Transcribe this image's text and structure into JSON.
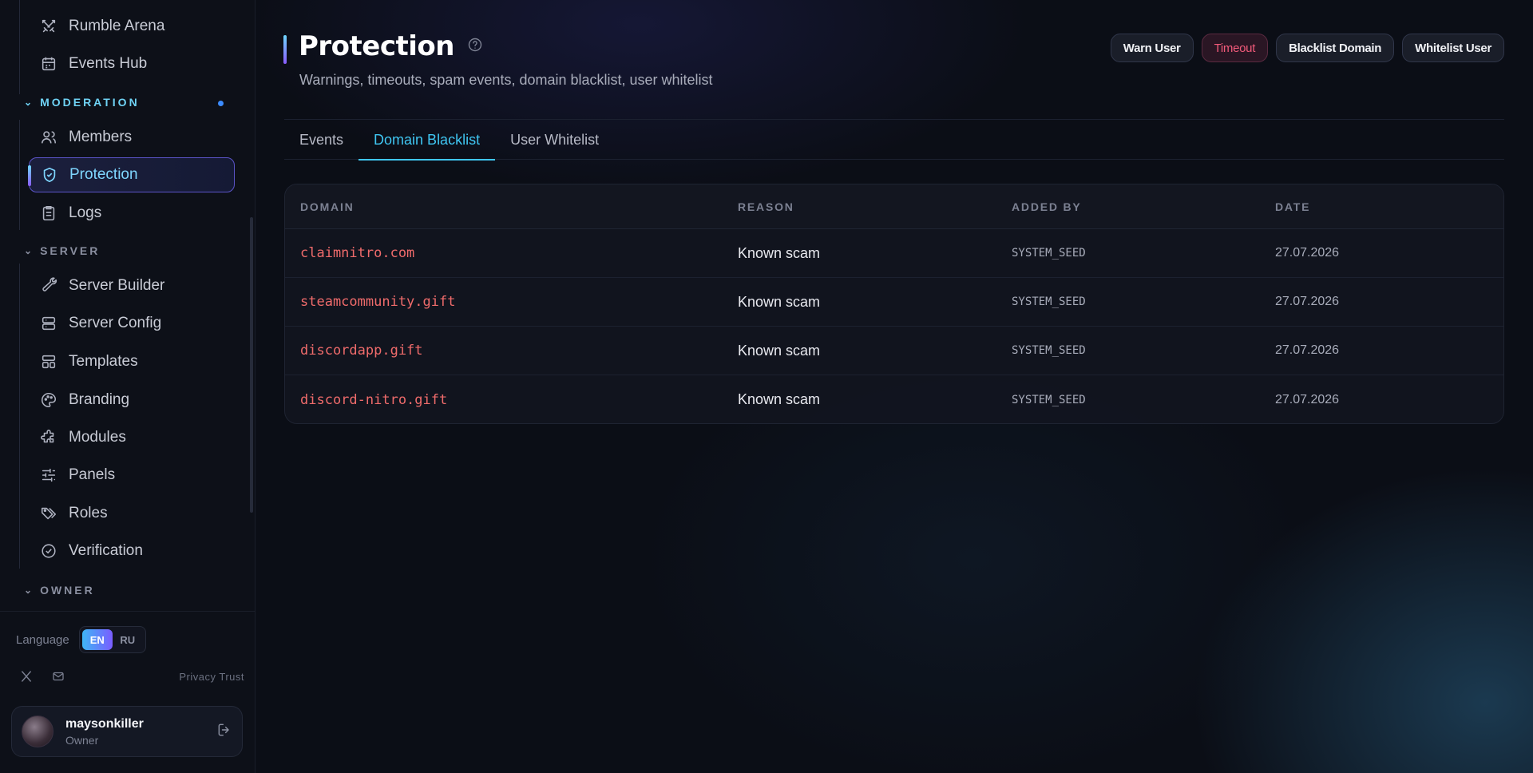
{
  "sidebar": {
    "top_items": [
      {
        "label": "Rumble Arena",
        "icon": "swords-icon"
      },
      {
        "label": "Events Hub",
        "icon": "calendar-icon"
      }
    ],
    "sections": {
      "moderation": "MODERATION",
      "server": "SERVER",
      "owner": "OWNER"
    },
    "moderation_items": [
      {
        "label": "Members",
        "icon": "users-icon"
      },
      {
        "label": "Protection",
        "icon": "shield-icon",
        "active": true
      },
      {
        "label": "Logs",
        "icon": "clipboard-icon"
      }
    ],
    "server_items": [
      {
        "label": "Server Builder",
        "icon": "wrench-icon"
      },
      {
        "label": "Server Config",
        "icon": "server-icon"
      },
      {
        "label": "Templates",
        "icon": "layout-icon"
      },
      {
        "label": "Branding",
        "icon": "palette-icon"
      },
      {
        "label": "Modules",
        "icon": "puzzle-icon"
      },
      {
        "label": "Panels",
        "icon": "sliders-icon"
      },
      {
        "label": "Roles",
        "icon": "tags-icon"
      },
      {
        "label": "Verification",
        "icon": "check-circle-icon"
      }
    ],
    "language": {
      "label": "Language",
      "options": [
        "EN",
        "RU"
      ],
      "selected": "EN"
    },
    "social": [
      "x-icon",
      "mail-icon"
    ],
    "legal": "Privacy Trust",
    "user": {
      "name": "maysonkiller",
      "role": "Owner"
    }
  },
  "page": {
    "title": "Protection",
    "subtitle": "Warnings, timeouts, spam events, domain blacklist, user whitelist",
    "actions": {
      "warn": "Warn User",
      "timeout": "Timeout",
      "blacklist": "Blacklist Domain",
      "whitelist": "Whitelist User"
    },
    "tabs": [
      {
        "label": "Events"
      },
      {
        "label": "Domain Blacklist",
        "active": true
      },
      {
        "label": "User Whitelist"
      }
    ]
  },
  "table": {
    "headers": [
      "DOMAIN",
      "REASON",
      "ADDED BY",
      "DATE"
    ],
    "rows": [
      {
        "domain": "claimnitro.com",
        "reason": "Known scam",
        "added_by": "SYSTEM_SEED",
        "date": "27.07.2026"
      },
      {
        "domain": "steamcommunity.gift",
        "reason": "Known scam",
        "added_by": "SYSTEM_SEED",
        "date": "27.07.2026"
      },
      {
        "domain": "discordapp.gift",
        "reason": "Known scam",
        "added_by": "SYSTEM_SEED",
        "date": "27.07.2026"
      },
      {
        "domain": "discord-nitro.gift",
        "reason": "Known scam",
        "added_by": "SYSTEM_SEED",
        "date": "27.07.2026"
      }
    ]
  },
  "colors": {
    "accent": "#3fc6f2",
    "danger": "#f25a7a",
    "domain_text": "#ef6b6b",
    "active_border": "#5b54c8"
  }
}
